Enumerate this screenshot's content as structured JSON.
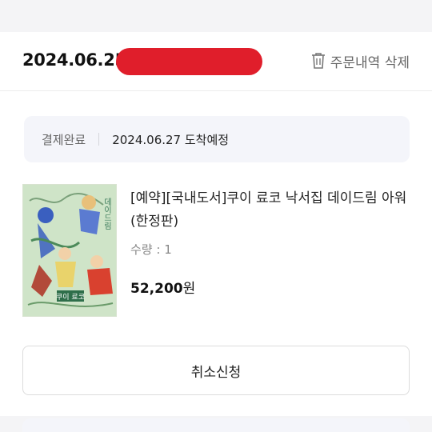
{
  "order": {
    "date_prefix": "2024.06.25(",
    "delete_label": "주문내역 삭제"
  },
  "status": {
    "label": "결제완료",
    "eta": "2024.06.27 도착예정"
  },
  "product": {
    "title": "[예약][국내도서]쿠이 료코 낙서집 데이드림 아워(한정판)",
    "qty": "수량 : 1",
    "price": "52,200",
    "currency": "원",
    "cover_title": "쿠이 료코",
    "cover_vertical": "데이드림"
  },
  "actions": {
    "cancel_label": "취소신청"
  },
  "colors": {
    "redaction": "#e01e2b",
    "status_bg": "#f4f5fa",
    "page_bg": "#f4f4f6",
    "cover_bg": "#cfe4c8"
  },
  "icons": {
    "delete": "trash-icon"
  }
}
